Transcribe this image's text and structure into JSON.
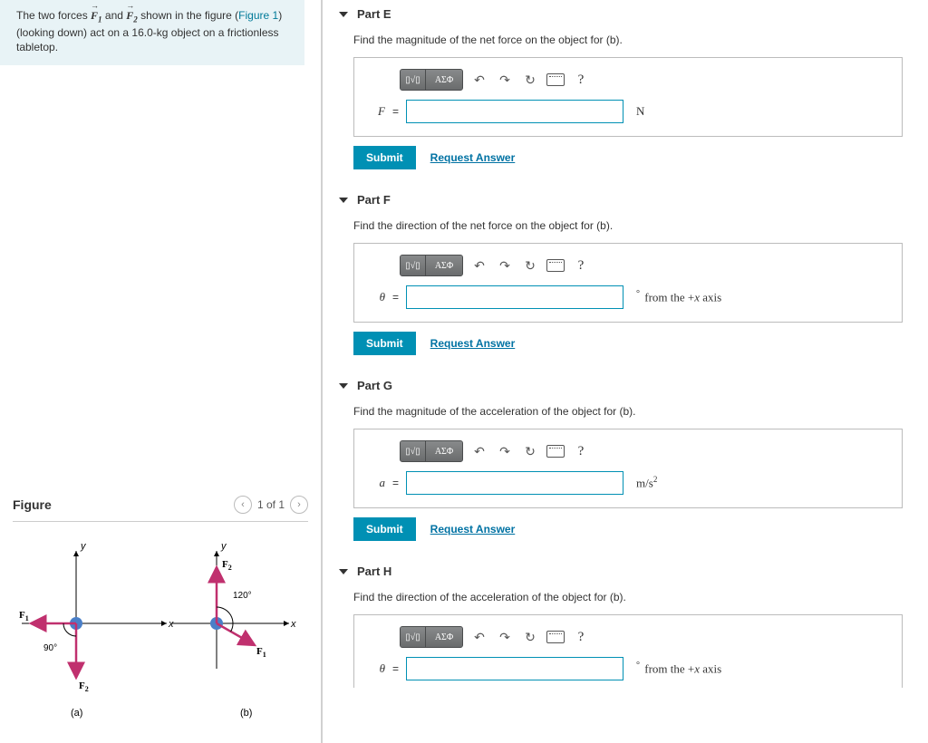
{
  "problem": {
    "text_pre": "The two forces ",
    "f1": "F",
    "f1_sub": "1",
    "text_and": " and ",
    "f2": "F",
    "f2_sub": "2",
    "text_mid": " shown in the figure (",
    "figure_link": "Figure 1",
    "text_post": ") (looking down) act on a 16.0-kg object on a frictionless tabletop."
  },
  "figure": {
    "title": "Figure",
    "nav_text": "1 of 1",
    "caption_a": "(a)",
    "caption_b": "(b)",
    "labels": {
      "x": "x",
      "y": "y",
      "f1": "F",
      "f1_sub": "1",
      "f2": "F",
      "f2_sub": "2",
      "ang90": "90°",
      "ang120": "120°"
    }
  },
  "parts": {
    "E": {
      "title": "Part E",
      "prompt": "Find the magnitude of the net force on the object for (b).",
      "var": "F",
      "unit_html": "N"
    },
    "F": {
      "title": "Part F",
      "prompt": "Find the direction of the net force on the object for (b).",
      "var": "θ",
      "unit_html": "from the +x axis",
      "unit_prefix": "°"
    },
    "G": {
      "title": "Part G",
      "prompt": "Find the magnitude of the acceleration of the object for (b).",
      "var": "a",
      "unit_html": "m/s²"
    },
    "H": {
      "title": "Part H",
      "prompt": "Find the direction of the acceleration of the object for (b).",
      "var": "θ",
      "unit_html": "from the +x axis",
      "unit_prefix": "°"
    }
  },
  "toolbar": {
    "fmt_label": "▯√▯",
    "greek_label": "ΑΣΦ",
    "undo": "↶",
    "redo": "↷",
    "reset": "↻",
    "help": "?"
  },
  "actions": {
    "submit": "Submit",
    "request": "Request Answer"
  }
}
